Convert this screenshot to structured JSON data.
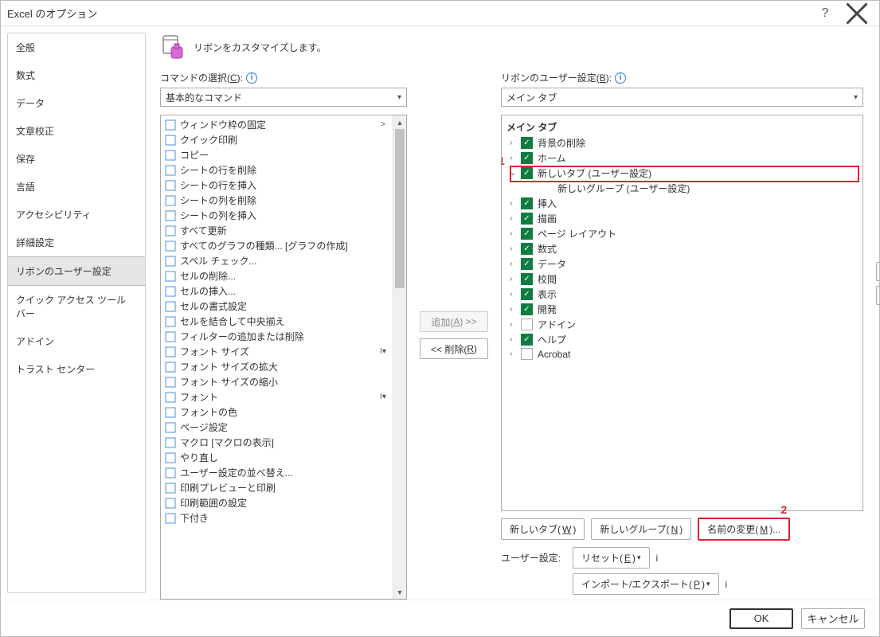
{
  "title": "Excel のオプション",
  "heading": "リボンをカスタマイズします。",
  "sidebar": {
    "items": [
      {
        "label": "全般"
      },
      {
        "label": "数式"
      },
      {
        "label": "データ"
      },
      {
        "label": "文章校正"
      },
      {
        "label": "保存"
      },
      {
        "label": "言語"
      },
      {
        "label": "アクセシビリティ"
      },
      {
        "label": "詳細設定"
      },
      {
        "label": "リボンのユーザー設定"
      },
      {
        "label": "クイック アクセス ツール バー"
      },
      {
        "label": "アドイン"
      },
      {
        "label": "トラスト センター"
      }
    ],
    "selected_index": 8
  },
  "left_col": {
    "label_prefix": "コマンドの選択(",
    "label_underline": "C",
    "label_suffix": "):",
    "combo_value": "基本的なコマンド",
    "items": [
      {
        "label": "ウィンドウ枠の固定",
        "trail": ">"
      },
      {
        "label": "クイック印刷"
      },
      {
        "label": "コピー"
      },
      {
        "label": "シートの行を削除"
      },
      {
        "label": "シートの行を挿入"
      },
      {
        "label": "シートの列を削除"
      },
      {
        "label": "シートの列を挿入"
      },
      {
        "label": "すべて更新"
      },
      {
        "label": "すべてのグラフの種類... [グラフの作成]"
      },
      {
        "label": "スペル チェック..."
      },
      {
        "label": "セルの削除..."
      },
      {
        "label": "セルの挿入..."
      },
      {
        "label": "セルの書式設定"
      },
      {
        "label": "セルを結合して中央揃え"
      },
      {
        "label": "フィルターの追加または削除"
      },
      {
        "label": "フォント サイズ",
        "trail": "I▾"
      },
      {
        "label": "フォント サイズの拡大"
      },
      {
        "label": "フォント サイズの縮小"
      },
      {
        "label": "フォント",
        "trail": "I▾"
      },
      {
        "label": "フォントの色"
      },
      {
        "label": "ページ設定"
      },
      {
        "label": "マクロ [マクロの表示]"
      },
      {
        "label": "やり直し"
      },
      {
        "label": "ユーザー設定の並べ替え..."
      },
      {
        "label": "印刷プレビューと印刷"
      },
      {
        "label": "印刷範囲の設定"
      },
      {
        "label": "下付き"
      }
    ]
  },
  "mid": {
    "add_prefix": "追加(",
    "add_u": "A",
    "add_suffix": ") >>",
    "remove_prefix": "<< 削除(",
    "remove_u": "R",
    "remove_suffix": ")"
  },
  "right_col": {
    "label_prefix": "リボンのユーザー設定(",
    "label_underline": "B",
    "label_suffix": "):",
    "combo_value": "メイン タブ",
    "tree_title": "メイン タブ",
    "items": [
      {
        "chev": ">",
        "checked": true,
        "label": "背景の削除"
      },
      {
        "chev": ">",
        "checked": true,
        "label": "ホーム"
      },
      {
        "chev": "v",
        "checked": true,
        "label": "新しいタブ (ユーザー設定)",
        "highlight": true
      },
      {
        "chev": "",
        "checked": null,
        "label": "新しいグループ (ユーザー設定)",
        "indent": 2
      },
      {
        "chev": ">",
        "checked": true,
        "label": "挿入"
      },
      {
        "chev": ">",
        "checked": true,
        "label": "描画"
      },
      {
        "chev": ">",
        "checked": true,
        "label": "ページ レイアウト"
      },
      {
        "chev": ">",
        "checked": true,
        "label": "数式"
      },
      {
        "chev": ">",
        "checked": true,
        "label": "データ"
      },
      {
        "chev": ">",
        "checked": true,
        "label": "校閲"
      },
      {
        "chev": ">",
        "checked": true,
        "label": "表示"
      },
      {
        "chev": ">",
        "checked": true,
        "label": "開発"
      },
      {
        "chev": ">",
        "checked": false,
        "label": "アドイン"
      },
      {
        "chev": ">",
        "checked": true,
        "label": "ヘルプ"
      },
      {
        "chev": ">",
        "checked": false,
        "label": "Acrobat"
      }
    ]
  },
  "bottom_buttons": {
    "new_tab_p": "新しいタブ(",
    "new_tab_u": "W",
    "new_tab_s": ")",
    "new_group_p": "新しいグループ(",
    "new_group_u": "N",
    "new_group_s": ")",
    "rename_p": "名前の変更(",
    "rename_u": "M",
    "rename_s": ")..."
  },
  "reset": {
    "label": "ユーザー設定:",
    "reset_p": "リセット(",
    "reset_u": "E",
    "reset_s": ")",
    "import_p": "インポート/エクスポート(",
    "import_u": "P",
    "import_s": ")"
  },
  "markers": {
    "one": "1",
    "two": "2"
  },
  "footer": {
    "ok": "OK",
    "cancel": "キャンセル"
  }
}
